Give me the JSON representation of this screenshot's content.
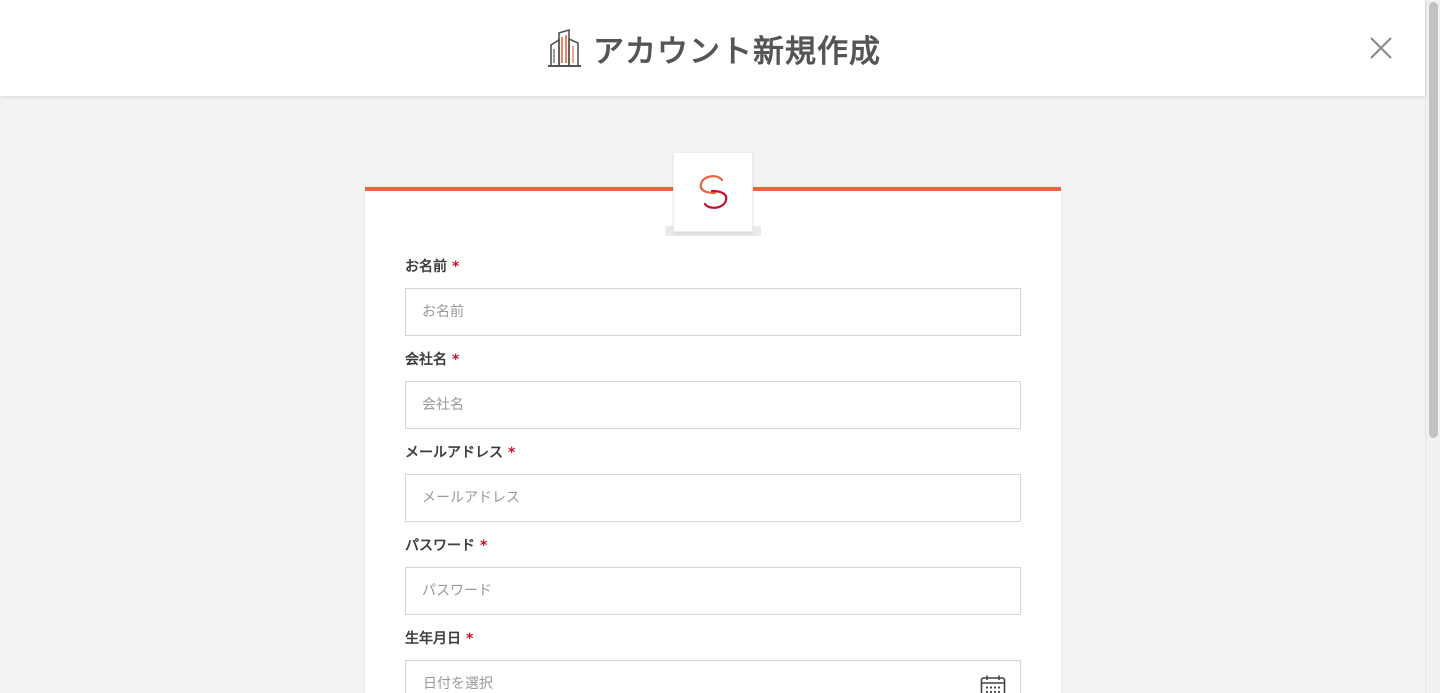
{
  "header": {
    "title": "アカウント新規作成",
    "logo_icon": "building-logo-icon",
    "close_icon": "close-icon"
  },
  "brand": {
    "accent_color": "#e8663d",
    "badge_icon": "s-logo-icon"
  },
  "form": {
    "required_mark": "*",
    "fields": [
      {
        "label": "お名前",
        "placeholder": "お名前",
        "value": ""
      },
      {
        "label": "会社名",
        "placeholder": "会社名",
        "value": ""
      },
      {
        "label": "メールアドレス",
        "placeholder": "メールアドレス",
        "value": ""
      },
      {
        "label": "パスワード",
        "placeholder": "パスワード",
        "value": ""
      },
      {
        "label": "生年月日",
        "placeholder": "日付を選択",
        "value": "",
        "icon": "calendar-icon"
      }
    ]
  }
}
